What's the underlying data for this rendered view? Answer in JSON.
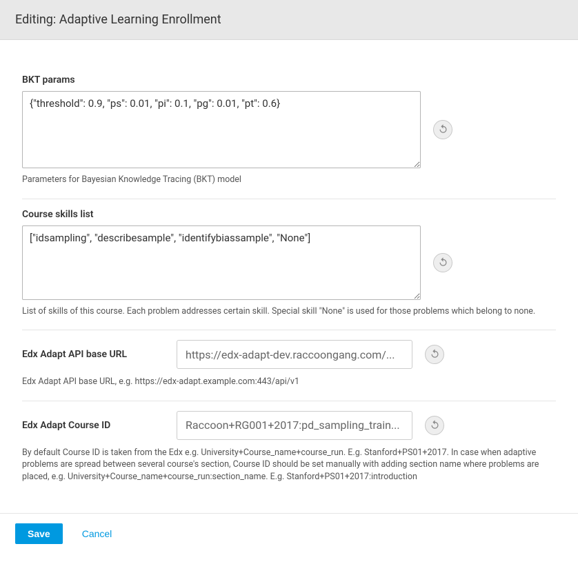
{
  "header": {
    "title": "Editing: Adaptive Learning Enrollment"
  },
  "fields": {
    "bkt": {
      "label": "BKT params",
      "value": "{\"threshold\": 0.9, \"ps\": 0.01, \"pi\": 0.1, \"pg\": 0.01, \"pt\": 0.6}",
      "help": "Parameters for Bayesian Knowledge Tracing (BKT) model"
    },
    "skills": {
      "label": "Course skills list",
      "value": "[\"idsampling\", \"describesample\", \"identifybiassample\", \"None\"]",
      "help": "List of skills of this course. Each problem addresses certain skill. Special skill \"None\" is used for those problems which belong to none."
    },
    "api_url": {
      "label": "Edx Adapt API base URL",
      "value": "https://edx-adapt-dev.raccoongang.com/...",
      "help": "Edx Adapt API base URL, e.g. https://edx-adapt.example.com:443/api/v1"
    },
    "course_id": {
      "label": "Edx Adapt Course ID",
      "value": "Raccoon+RG001+2017:pd_sampling_train...",
      "help": "By default Course ID is taken from the Edx e.g. University+Course_name+course_run. E.g. Stanford+PS01+2017. In case when adaptive problems are spread between several course's section, Course ID should be set manually with adding section name where problems are placed, e.g. University+Course_name+course_run:section_name. E.g. Stanford+PS01+2017:introduction"
    }
  },
  "footer": {
    "save": "Save",
    "cancel": "Cancel"
  }
}
